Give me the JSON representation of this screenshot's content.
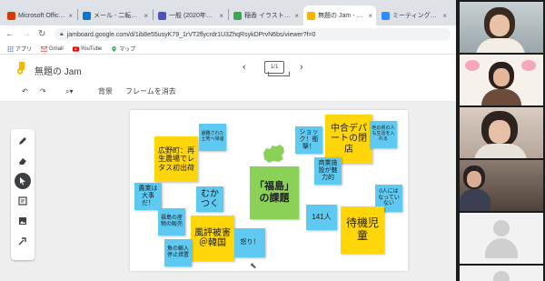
{
  "colors": {
    "yellow_note": "#ffd60a",
    "blue_note": "#5ecaf1",
    "green_note": "#8bd158",
    "brand_jam": "#f4b400"
  },
  "browser": {
    "tabs": [
      {
        "title": "Microsoft Office ホー",
        "favicon": "office-icon",
        "color": "#d83b01"
      },
      {
        "title": "メール - 二転手優子",
        "favicon": "outlook-icon",
        "color": "#0078d4"
      },
      {
        "title": "一般 (2020年度 短",
        "favicon": "teams-icon",
        "color": "#4b53bc"
      },
      {
        "title": "稲香 イラスト - Google",
        "favicon": "google-icon",
        "color": "#34a853"
      },
      {
        "title": "無題の Jam - Google",
        "favicon": "jamboard-icon",
        "color": "#f4b400"
      },
      {
        "title": "ミーティング情報 - Zoo",
        "favicon": "zoom-icon",
        "color": "#2d8cff"
      }
    ],
    "url": "jamboard.google.com/d/1ib8e55usyK79_1rVT2flycrdr1U3ZhqRsykDPrvN6bs/viewer?f=0",
    "bookmarks": [
      {
        "label": "アプリ",
        "icon": "apps-icon"
      },
      {
        "label": "Gmail",
        "icon": "gmail-icon"
      },
      {
        "label": "YouTube",
        "icon": "youtube-icon"
      },
      {
        "label": "マップ",
        "icon": "maps-icon"
      }
    ]
  },
  "app": {
    "title": "無題の Jam",
    "frame_counter": "1/1",
    "toolbar": {
      "zoom": "",
      "background": "背景",
      "clear": "フレームを消去"
    }
  },
  "notes": [
    {
      "text": "広野町：再生農場でレタス初出荷",
      "color": "yellow"
    },
    {
      "text": "避難された土地へ帰還",
      "color": "blue"
    },
    {
      "text": "農業は大事だ！",
      "color": "blue"
    },
    {
      "text": "むかつく",
      "color": "blue"
    },
    {
      "text": "福島の産物の販売",
      "color": "blue"
    },
    {
      "text": "風評被害＠韓国",
      "color": "yellow"
    },
    {
      "text": "魚の輸入停止措置",
      "color": "blue"
    },
    {
      "text": "怒り！",
      "color": "blue"
    },
    {
      "text": "「福島」の課題",
      "color": "green"
    },
    {
      "text": "ショック！衝撃！",
      "color": "blue"
    },
    {
      "text": "中合デパートの閉店",
      "color": "yellow"
    },
    {
      "text": "他の県の人も生活を入れる",
      "color": "blue"
    },
    {
      "text": "商業施設が魅力的",
      "color": "blue"
    },
    {
      "text": "0人にはなっていない",
      "color": "blue"
    },
    {
      "text": "141人",
      "color": "blue"
    },
    {
      "text": "待機児童",
      "color": "yellow"
    }
  ]
}
